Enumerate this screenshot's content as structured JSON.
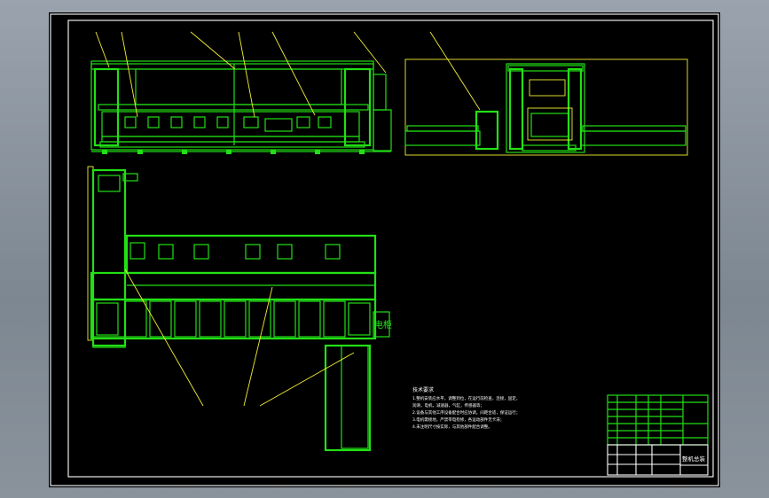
{
  "drawing": {
    "notes_title": "技术要求",
    "notes_lines": [
      "1.整机安装应水平，调整到位，在运行前检查，连接，固定，",
      "润滑，电机，减速器，气缸，传感器等；",
      "2.设备与其他工序设备配合时应协调，间距合适，保证运行；",
      "3.电机需接地，严禁带电检修，各运动部件无卡滞；",
      "4.未注明尺寸按实际，与其他部件配合调整。"
    ],
    "cabinet_label": "电柜",
    "title_block": {
      "name": "整机总装"
    }
  },
  "colors": {
    "background": "#000000",
    "outline": "#22e015",
    "leader": "#f2ef33",
    "frame": "#ffffff"
  }
}
